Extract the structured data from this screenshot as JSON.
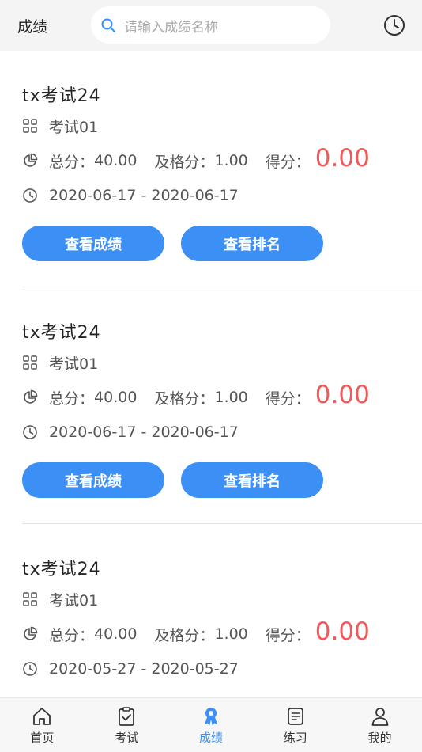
{
  "header": {
    "title": "成绩",
    "search_placeholder": "请输入成绩名称"
  },
  "records": [
    {
      "name": "tx考试24",
      "category": "考试01",
      "total_label": "总分：",
      "total": "40.00",
      "pass_label": "及格分：",
      "pass": "1.00",
      "score_label": "得分：",
      "score": "0.00",
      "date_range": "2020-06-17 - 2020-06-17",
      "view_score_label": "查看成绩",
      "view_rank_label": "查看排名"
    },
    {
      "name": "tx考试24",
      "category": "考试01",
      "total_label": "总分：",
      "total": "40.00",
      "pass_label": "及格分：",
      "pass": "1.00",
      "score_label": "得分：",
      "score": "0.00",
      "date_range": "2020-06-17 - 2020-06-17",
      "view_score_label": "查看成绩",
      "view_rank_label": "查看排名"
    },
    {
      "name": "tx考试24",
      "category": "考试01",
      "total_label": "总分：",
      "total": "40.00",
      "pass_label": "及格分：",
      "pass": "1.00",
      "score_label": "得分：",
      "score": "0.00",
      "date_range": "2020-05-27 - 2020-05-27"
    }
  ],
  "tabs": [
    {
      "label": "首页",
      "icon": "home-icon"
    },
    {
      "label": "考试",
      "icon": "exam-clipboard-icon"
    },
    {
      "label": "成绩",
      "icon": "award-ribbon-icon",
      "active": true
    },
    {
      "label": "练习",
      "icon": "practice-doc-icon"
    },
    {
      "label": "我的",
      "icon": "user-icon"
    }
  ],
  "colors": {
    "accent": "#3b8ff5",
    "score": "#f25a5a",
    "header_bg": "#f4f4f4"
  }
}
